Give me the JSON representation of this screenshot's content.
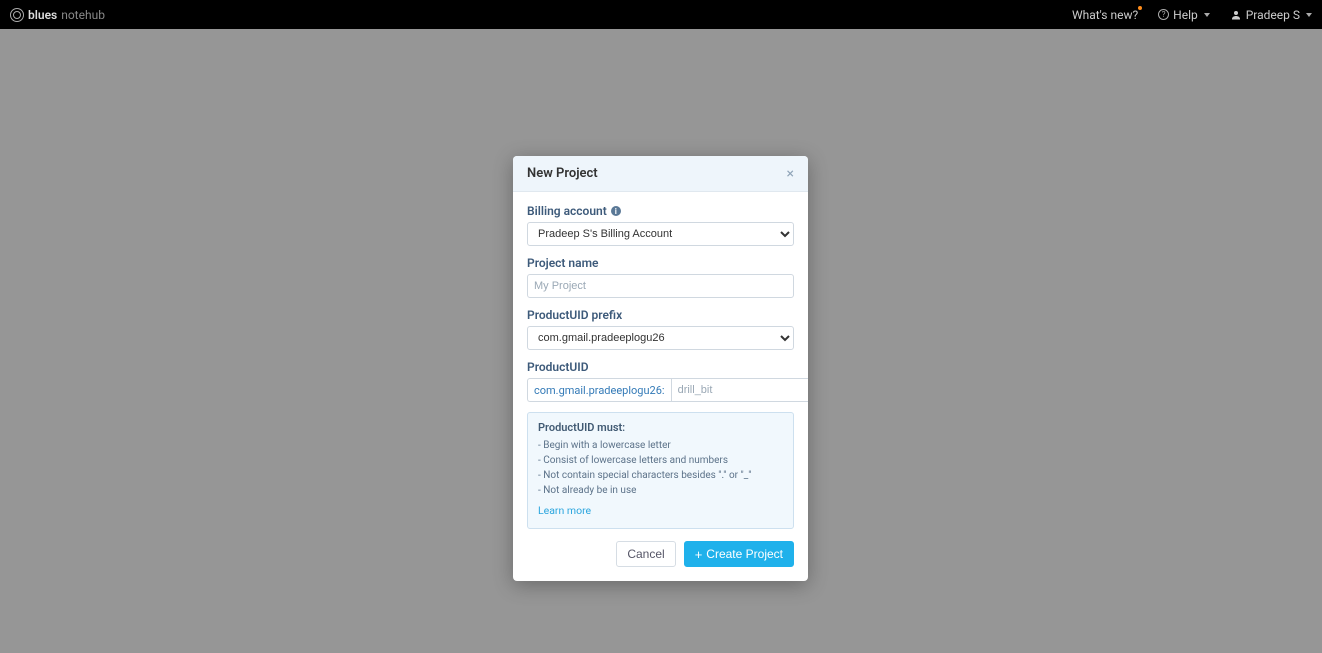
{
  "topbar": {
    "brand_bold": "blues",
    "brand_sub": "notehub",
    "whats_new": "What's new?",
    "help": "Help",
    "user": "Pradeep S"
  },
  "modal": {
    "title": "New Project",
    "billing_label": "Billing account",
    "billing_value": "Pradeep S's Billing Account",
    "project_name_label": "Project name",
    "project_name_placeholder": "My Project",
    "project_name_value": "",
    "prefix_label": "ProductUID prefix",
    "prefix_value": "com.gmail.pradeeplogu26",
    "uid_label": "ProductUID",
    "uid_prefix_text": "com.gmail.pradeeplogu26:",
    "uid_placeholder": "drill_bit",
    "uid_value": "",
    "info_title": "ProductUID must:",
    "info_rules": [
      "Begin with a lowercase letter",
      "Consist of lowercase letters and numbers",
      "Not contain special characters besides \".\" or \"_\"",
      "Not already be in use"
    ],
    "learn_more": "Learn more",
    "cancel": "Cancel",
    "create": "Create Project"
  }
}
